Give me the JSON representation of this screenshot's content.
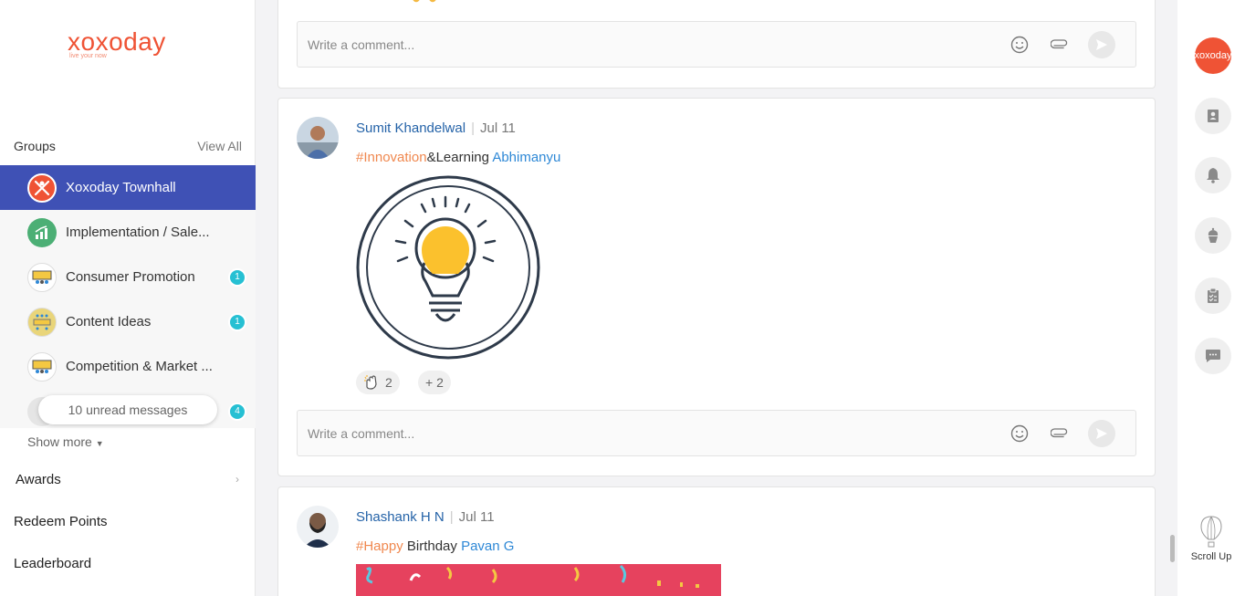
{
  "sidebar": {
    "logo_text": "xoxoday",
    "logo_tagline": "live your now",
    "groups_title": "Groups",
    "view_all": "View All",
    "groups": [
      {
        "label": "Xoxoday Townhall",
        "badge": ""
      },
      {
        "label": "Implementation / Sale...",
        "badge": ""
      },
      {
        "label": "Consumer Promotion",
        "badge": "1"
      },
      {
        "label": "Content Ideas",
        "badge": "1"
      },
      {
        "label": "Competition & Market ...",
        "badge": ""
      },
      {
        "label": "",
        "badge": "4"
      }
    ],
    "unread_messages": "10 unread messages",
    "show_more": "Show more",
    "nav": {
      "awards": "Awards",
      "redeem": "Redeem Points",
      "leaderboard": "Leaderboard"
    }
  },
  "feed": {
    "comment_placeholder": "Write a comment...",
    "posts": [
      {
        "author": "Sumit Khandelwal",
        "date": "Jul 11",
        "hashtag": "#Innovation",
        "text": "&Learning",
        "mention": "Abhimanyu",
        "reactions": [
          {
            "icon": "clap-icon",
            "count": "2"
          },
          {
            "icon": "plus-icon",
            "count": "+ 2"
          }
        ]
      },
      {
        "author": "Shashank H N",
        "date": "Jul 11",
        "hashtag": "#Happy",
        "text": " Birthday",
        "mention": "Pavan G"
      }
    ]
  },
  "right_rail": {
    "logo_text": "xoxoday",
    "icons": [
      "contacts-icon",
      "bell-icon",
      "cupcake-icon",
      "clipboard-icon",
      "chat-icon"
    ],
    "scroll_up": "Scroll Up"
  },
  "colors": {
    "brand": "#ef5335",
    "active_group": "#3f51b5",
    "badge": "#26c0d3",
    "author": "#2563a8",
    "hashtag": "#f0884f",
    "mention": "#2e88d6"
  }
}
